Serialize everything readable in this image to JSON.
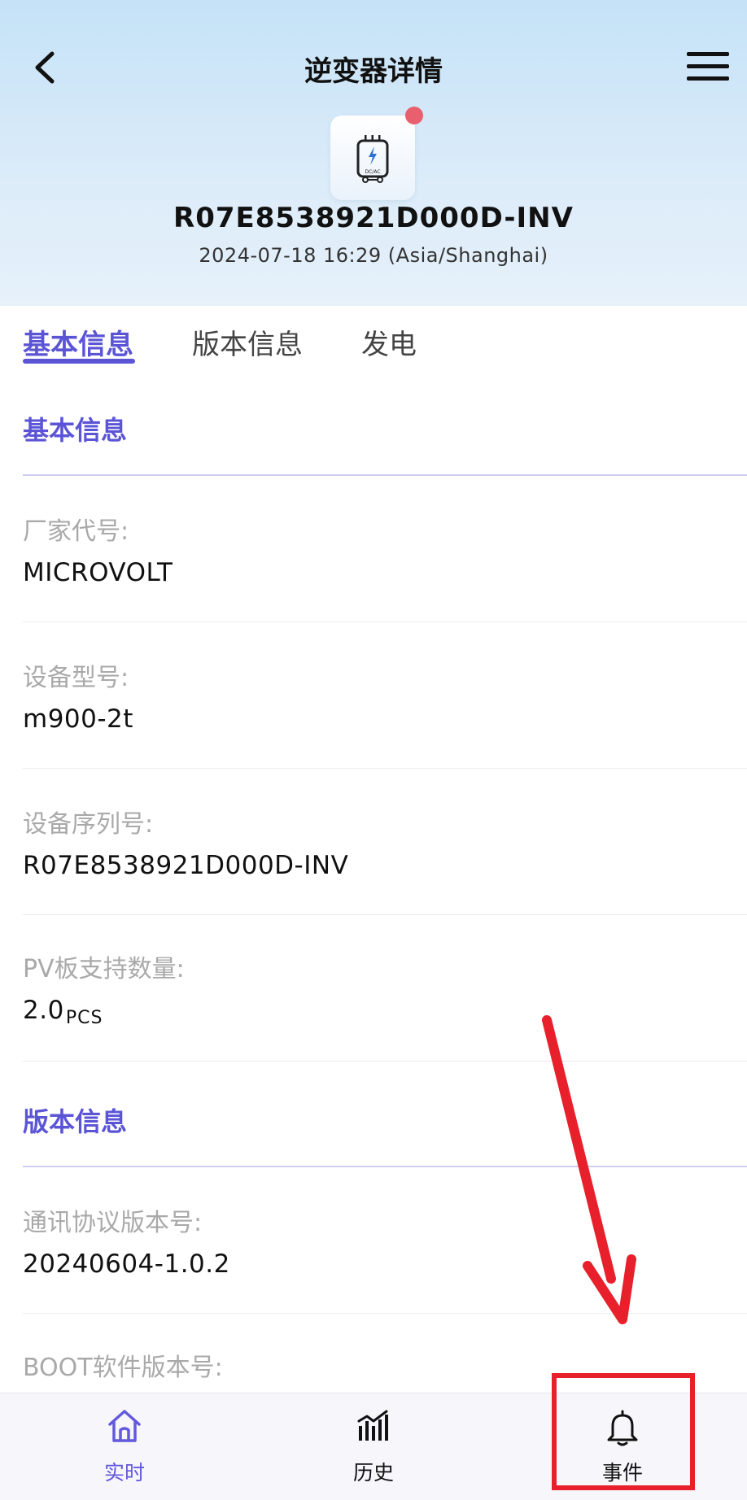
{
  "header": {
    "title": "逆变器详情",
    "device_id": "R07E8538921D000D-INV",
    "device_time": "2024-07-18 16:29 (Asia/Shanghai)",
    "device_icon_text": "DC/AC",
    "icons": {
      "back": "back-arrow-icon",
      "menu": "hamburger-menu-icon",
      "device": "inverter-icon",
      "notification": "red-dot-badge"
    },
    "colors": {
      "badge": "#e8606e"
    }
  },
  "tabs": [
    {
      "label": "基本信息",
      "active": true
    },
    {
      "label": "版本信息",
      "active": false
    },
    {
      "label": "发电",
      "active": false
    }
  ],
  "sections": {
    "basic": {
      "title": "基本信息",
      "fields": [
        {
          "label": "厂家代号:",
          "value": "MICROVOLT"
        },
        {
          "label": "设备型号:",
          "value": "m900-2t"
        },
        {
          "label": "设备序列号:",
          "value": "R07E8538921D000D-INV"
        },
        {
          "label": "PV板支持数量:",
          "value": "2.0",
          "unit": "PCS"
        }
      ]
    },
    "version": {
      "title": "版本信息",
      "fields": [
        {
          "label": "通讯协议版本号:",
          "value": "20240604-1.0.2"
        },
        {
          "label": "BOOT软件版本号:",
          "value": ""
        }
      ]
    }
  },
  "bottom_nav": [
    {
      "label": "实时",
      "icon": "home-icon",
      "active": true
    },
    {
      "label": "历史",
      "icon": "bar-chart-icon",
      "active": false
    },
    {
      "label": "事件",
      "icon": "bell-icon",
      "active": false
    }
  ],
  "colors": {
    "accent": "#5b55d6",
    "annotation": "#e8202c"
  }
}
